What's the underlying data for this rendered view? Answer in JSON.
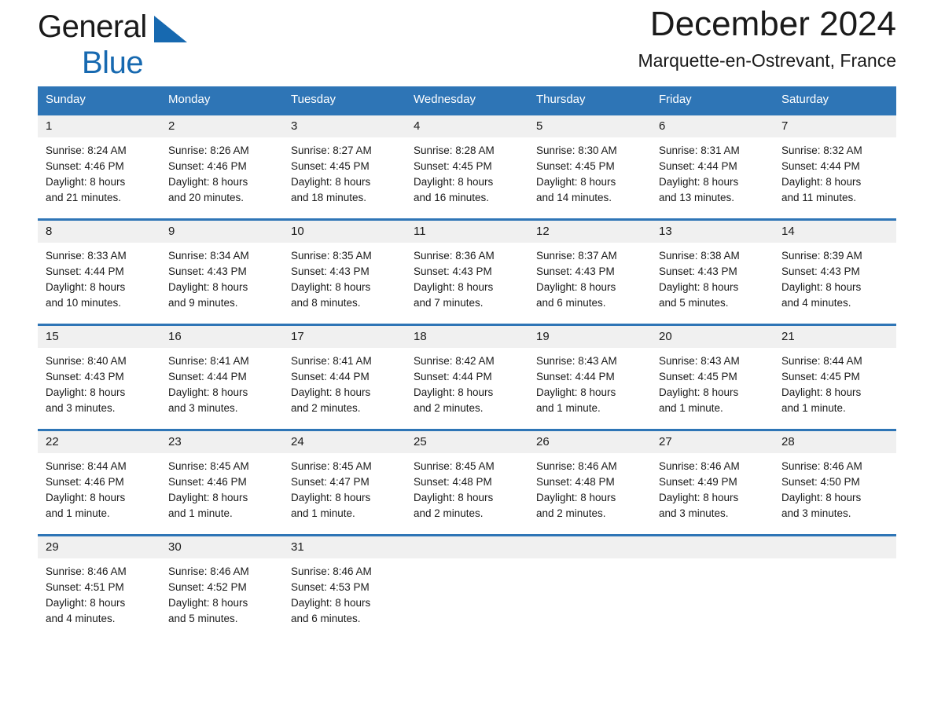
{
  "brand": {
    "name_top": "General",
    "name_bottom": "Blue",
    "accent_color": "#1769b0"
  },
  "header": {
    "title": "December 2024",
    "subtitle": "Marquette-en-Ostrevant, France"
  },
  "theme": {
    "header_bg": "#2e75b6",
    "daynum_bg": "#f0f0f0",
    "text": "#1a1a1a"
  },
  "weekday_headers": [
    "Sunday",
    "Monday",
    "Tuesday",
    "Wednesday",
    "Thursday",
    "Friday",
    "Saturday"
  ],
  "weeks": [
    [
      {
        "day": "1",
        "sunrise": "Sunrise: 8:24 AM",
        "sunset": "Sunset: 4:46 PM",
        "daylight_line1": "Daylight: 8 hours",
        "daylight_line2": "and 21 minutes."
      },
      {
        "day": "2",
        "sunrise": "Sunrise: 8:26 AM",
        "sunset": "Sunset: 4:46 PM",
        "daylight_line1": "Daylight: 8 hours",
        "daylight_line2": "and 20 minutes."
      },
      {
        "day": "3",
        "sunrise": "Sunrise: 8:27 AM",
        "sunset": "Sunset: 4:45 PM",
        "daylight_line1": "Daylight: 8 hours",
        "daylight_line2": "and 18 minutes."
      },
      {
        "day": "4",
        "sunrise": "Sunrise: 8:28 AM",
        "sunset": "Sunset: 4:45 PM",
        "daylight_line1": "Daylight: 8 hours",
        "daylight_line2": "and 16 minutes."
      },
      {
        "day": "5",
        "sunrise": "Sunrise: 8:30 AM",
        "sunset": "Sunset: 4:45 PM",
        "daylight_line1": "Daylight: 8 hours",
        "daylight_line2": "and 14 minutes."
      },
      {
        "day": "6",
        "sunrise": "Sunrise: 8:31 AM",
        "sunset": "Sunset: 4:44 PM",
        "daylight_line1": "Daylight: 8 hours",
        "daylight_line2": "and 13 minutes."
      },
      {
        "day": "7",
        "sunrise": "Sunrise: 8:32 AM",
        "sunset": "Sunset: 4:44 PM",
        "daylight_line1": "Daylight: 8 hours",
        "daylight_line2": "and 11 minutes."
      }
    ],
    [
      {
        "day": "8",
        "sunrise": "Sunrise: 8:33 AM",
        "sunset": "Sunset: 4:44 PM",
        "daylight_line1": "Daylight: 8 hours",
        "daylight_line2": "and 10 minutes."
      },
      {
        "day": "9",
        "sunrise": "Sunrise: 8:34 AM",
        "sunset": "Sunset: 4:43 PM",
        "daylight_line1": "Daylight: 8 hours",
        "daylight_line2": "and 9 minutes."
      },
      {
        "day": "10",
        "sunrise": "Sunrise: 8:35 AM",
        "sunset": "Sunset: 4:43 PM",
        "daylight_line1": "Daylight: 8 hours",
        "daylight_line2": "and 8 minutes."
      },
      {
        "day": "11",
        "sunrise": "Sunrise: 8:36 AM",
        "sunset": "Sunset: 4:43 PM",
        "daylight_line1": "Daylight: 8 hours",
        "daylight_line2": "and 7 minutes."
      },
      {
        "day": "12",
        "sunrise": "Sunrise: 8:37 AM",
        "sunset": "Sunset: 4:43 PM",
        "daylight_line1": "Daylight: 8 hours",
        "daylight_line2": "and 6 minutes."
      },
      {
        "day": "13",
        "sunrise": "Sunrise: 8:38 AM",
        "sunset": "Sunset: 4:43 PM",
        "daylight_line1": "Daylight: 8 hours",
        "daylight_line2": "and 5 minutes."
      },
      {
        "day": "14",
        "sunrise": "Sunrise: 8:39 AM",
        "sunset": "Sunset: 4:43 PM",
        "daylight_line1": "Daylight: 8 hours",
        "daylight_line2": "and 4 minutes."
      }
    ],
    [
      {
        "day": "15",
        "sunrise": "Sunrise: 8:40 AM",
        "sunset": "Sunset: 4:43 PM",
        "daylight_line1": "Daylight: 8 hours",
        "daylight_line2": "and 3 minutes."
      },
      {
        "day": "16",
        "sunrise": "Sunrise: 8:41 AM",
        "sunset": "Sunset: 4:44 PM",
        "daylight_line1": "Daylight: 8 hours",
        "daylight_line2": "and 3 minutes."
      },
      {
        "day": "17",
        "sunrise": "Sunrise: 8:41 AM",
        "sunset": "Sunset: 4:44 PM",
        "daylight_line1": "Daylight: 8 hours",
        "daylight_line2": "and 2 minutes."
      },
      {
        "day": "18",
        "sunrise": "Sunrise: 8:42 AM",
        "sunset": "Sunset: 4:44 PM",
        "daylight_line1": "Daylight: 8 hours",
        "daylight_line2": "and 2 minutes."
      },
      {
        "day": "19",
        "sunrise": "Sunrise: 8:43 AM",
        "sunset": "Sunset: 4:44 PM",
        "daylight_line1": "Daylight: 8 hours",
        "daylight_line2": "and 1 minute."
      },
      {
        "day": "20",
        "sunrise": "Sunrise: 8:43 AM",
        "sunset": "Sunset: 4:45 PM",
        "daylight_line1": "Daylight: 8 hours",
        "daylight_line2": "and 1 minute."
      },
      {
        "day": "21",
        "sunrise": "Sunrise: 8:44 AM",
        "sunset": "Sunset: 4:45 PM",
        "daylight_line1": "Daylight: 8 hours",
        "daylight_line2": "and 1 minute."
      }
    ],
    [
      {
        "day": "22",
        "sunrise": "Sunrise: 8:44 AM",
        "sunset": "Sunset: 4:46 PM",
        "daylight_line1": "Daylight: 8 hours",
        "daylight_line2": "and 1 minute."
      },
      {
        "day": "23",
        "sunrise": "Sunrise: 8:45 AM",
        "sunset": "Sunset: 4:46 PM",
        "daylight_line1": "Daylight: 8 hours",
        "daylight_line2": "and 1 minute."
      },
      {
        "day": "24",
        "sunrise": "Sunrise: 8:45 AM",
        "sunset": "Sunset: 4:47 PM",
        "daylight_line1": "Daylight: 8 hours",
        "daylight_line2": "and 1 minute."
      },
      {
        "day": "25",
        "sunrise": "Sunrise: 8:45 AM",
        "sunset": "Sunset: 4:48 PM",
        "daylight_line1": "Daylight: 8 hours",
        "daylight_line2": "and 2 minutes."
      },
      {
        "day": "26",
        "sunrise": "Sunrise: 8:46 AM",
        "sunset": "Sunset: 4:48 PM",
        "daylight_line1": "Daylight: 8 hours",
        "daylight_line2": "and 2 minutes."
      },
      {
        "day": "27",
        "sunrise": "Sunrise: 8:46 AM",
        "sunset": "Sunset: 4:49 PM",
        "daylight_line1": "Daylight: 8 hours",
        "daylight_line2": "and 3 minutes."
      },
      {
        "day": "28",
        "sunrise": "Sunrise: 8:46 AM",
        "sunset": "Sunset: 4:50 PM",
        "daylight_line1": "Daylight: 8 hours",
        "daylight_line2": "and 3 minutes."
      }
    ],
    [
      {
        "day": "29",
        "sunrise": "Sunrise: 8:46 AM",
        "sunset": "Sunset: 4:51 PM",
        "daylight_line1": "Daylight: 8 hours",
        "daylight_line2": "and 4 minutes."
      },
      {
        "day": "30",
        "sunrise": "Sunrise: 8:46 AM",
        "sunset": "Sunset: 4:52 PM",
        "daylight_line1": "Daylight: 8 hours",
        "daylight_line2": "and 5 minutes."
      },
      {
        "day": "31",
        "sunrise": "Sunrise: 8:46 AM",
        "sunset": "Sunset: 4:53 PM",
        "daylight_line1": "Daylight: 8 hours",
        "daylight_line2": "and 6 minutes."
      },
      {
        "day": "",
        "sunrise": "",
        "sunset": "",
        "daylight_line1": "",
        "daylight_line2": ""
      },
      {
        "day": "",
        "sunrise": "",
        "sunset": "",
        "daylight_line1": "",
        "daylight_line2": ""
      },
      {
        "day": "",
        "sunrise": "",
        "sunset": "",
        "daylight_line1": "",
        "daylight_line2": ""
      },
      {
        "day": "",
        "sunrise": "",
        "sunset": "",
        "daylight_line1": "",
        "daylight_line2": ""
      }
    ]
  ]
}
